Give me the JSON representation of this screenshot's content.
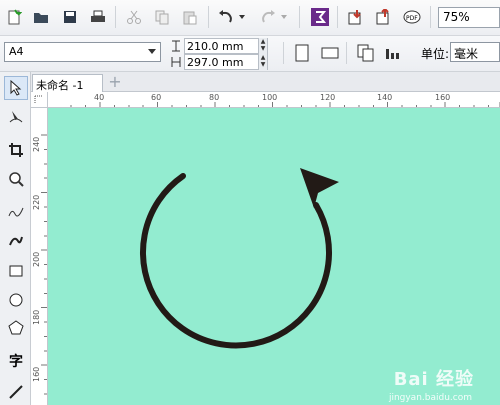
{
  "toolbar": {
    "zoom": "75%",
    "icons": [
      "new-document",
      "open-folder",
      "save",
      "print",
      "cut",
      "copy",
      "paste",
      "undo",
      "redo",
      "app-launcher",
      "import",
      "export",
      "publish-pdf"
    ]
  },
  "property_bar": {
    "page_size": "A4",
    "width": "210.0 mm",
    "height": "297.0 mm",
    "units_label": "单位:",
    "units_value": "毫米"
  },
  "document_tab": {
    "title": "未命名 -1"
  },
  "toolbox": {
    "text_tool_glyph": "字"
  },
  "ruler": {
    "horizontal_labels": [
      "40",
      "60",
      "80",
      "100",
      "120",
      "140",
      "160"
    ],
    "vertical_labels": [
      "240",
      "220",
      "200",
      "180",
      "160"
    ]
  },
  "canvas": {
    "background_color": "#93ecd0",
    "shape": "circular-arrow",
    "stroke_color": "#221a16"
  },
  "watermark": {
    "text": "Bai 经验",
    "sub": "jingyan.baidu.com"
  }
}
